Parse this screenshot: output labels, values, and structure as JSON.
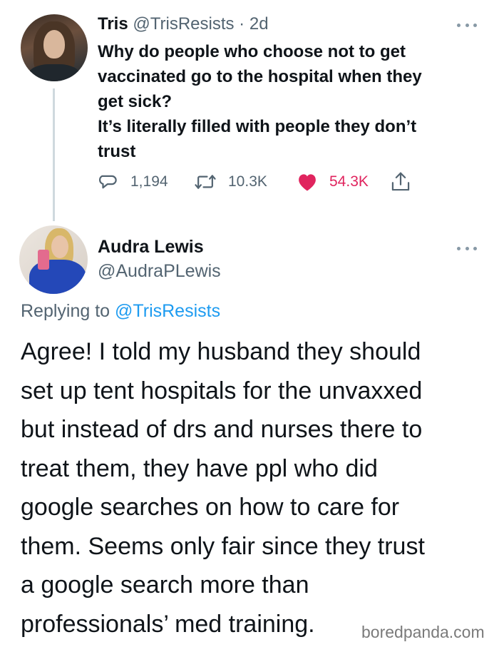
{
  "tweet1": {
    "name": "Tris",
    "handle": "@TrisResists",
    "separator": " · ",
    "time": "2d",
    "lines": [
      "Why do people who choose not to get",
      "vaccinated go to the hospital when they",
      "get sick?",
      "It’s literally filled with people they don’t",
      "trust"
    ],
    "stats": {
      "replies": "1,194",
      "retweets": "10.3K",
      "likes": "54.3K"
    },
    "icons": {
      "reply": "reply-bubble-icon",
      "retweet": "retweet-icon",
      "like": "heart-icon",
      "share": "share-icon"
    }
  },
  "tweet2": {
    "name": "Audra Lewis",
    "handle": "@AudraPLewis",
    "replying_prefix": "Replying to ",
    "replying_to": "@TrisResists",
    "lines": [
      "Agree! I told my husband they should",
      "set up tent hospitals for the unvaxxed",
      "but instead of drs and nurses there to",
      "treat them, they have ppl who did",
      "google searches on how to care for",
      "them. Seems only fair since they trust",
      "a google search more than",
      "professionals’ med training."
    ]
  },
  "watermark": "boredpanda.com",
  "colors": {
    "text": "#0f1419",
    "secondary": "#536471",
    "link": "#1d9bf0",
    "like": "#e0245e"
  }
}
